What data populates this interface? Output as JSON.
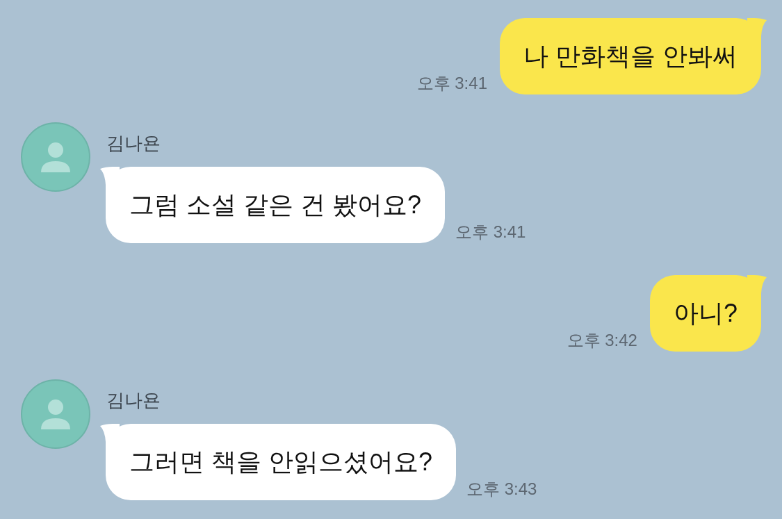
{
  "messages": [
    {
      "kind": "sent",
      "text": "나 만화책을 안봐써",
      "time": "오후 3:41"
    },
    {
      "kind": "received",
      "sender": "김나욘",
      "text": "그럼 소설 같은 건 봤어요?",
      "time": "오후 3:41"
    },
    {
      "kind": "sent",
      "text": "아니?",
      "time": "오후 3:42"
    },
    {
      "kind": "received",
      "sender": "김나욘",
      "text": "그러면 책을 안읽으셨어요?",
      "time": "오후 3:43"
    }
  ]
}
